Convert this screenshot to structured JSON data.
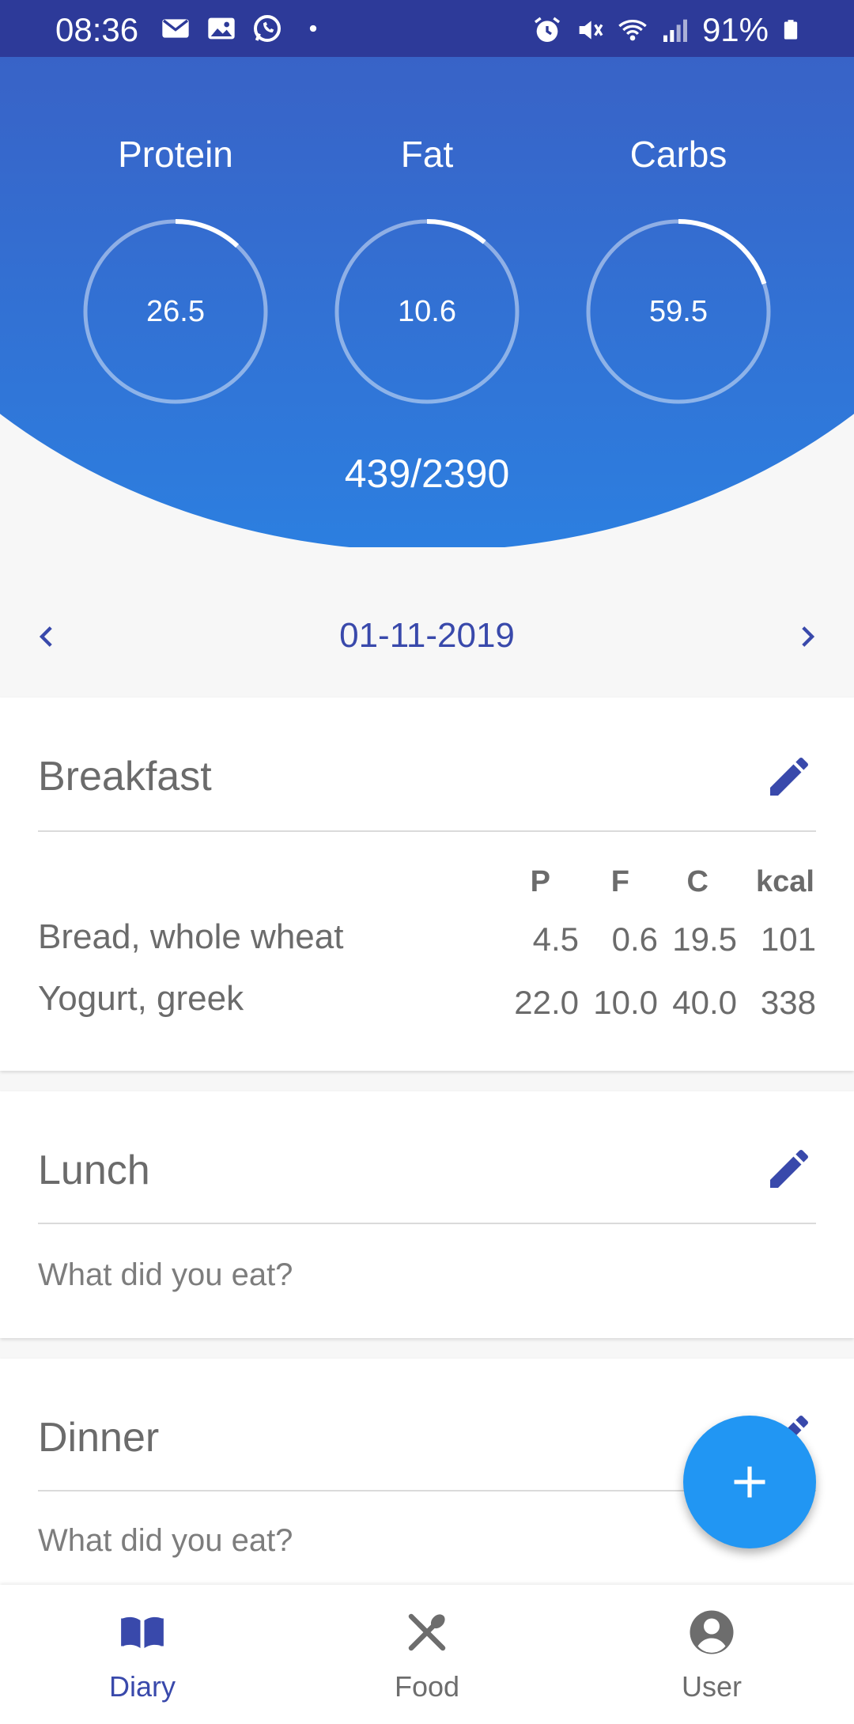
{
  "status_bar": {
    "time": "08:36",
    "battery": "91%"
  },
  "macros": [
    {
      "label": "Protein",
      "value": "26.5",
      "progress": 0.12
    },
    {
      "label": "Fat",
      "value": "10.6",
      "progress": 0.11
    },
    {
      "label": "Carbs",
      "value": "59.5",
      "progress": 0.2
    }
  ],
  "calories": "439/2390",
  "date_nav": {
    "date": "01-11-2019"
  },
  "breakfast": {
    "title": "Breakfast",
    "columns": [
      "P",
      "F",
      "C",
      "kcal"
    ],
    "items": [
      {
        "name": "Bread, whole wheat",
        "p": "4.5",
        "f": "0.6",
        "c": "19.5",
        "kcal": "101"
      },
      {
        "name": "Yogurt, greek",
        "p": "22.0",
        "f": "10.0",
        "c": "40.0",
        "kcal": "338"
      }
    ]
  },
  "lunch": {
    "title": "Lunch",
    "placeholder": "What did you eat?"
  },
  "dinner": {
    "title": "Dinner",
    "placeholder": "What did you eat?"
  },
  "fab": {
    "icon": "plus-icon"
  },
  "bottom_nav": {
    "items": [
      {
        "label": "Diary",
        "icon": "book-icon",
        "active": true
      },
      {
        "label": "Food",
        "icon": "utensils-icon",
        "active": false
      },
      {
        "label": "User",
        "icon": "account-icon",
        "active": false
      }
    ]
  },
  "colors": {
    "primary": "#3949ab",
    "accent": "#2196f3",
    "status_bar": "#2d3a99",
    "inactive": "#6d6d6d"
  }
}
